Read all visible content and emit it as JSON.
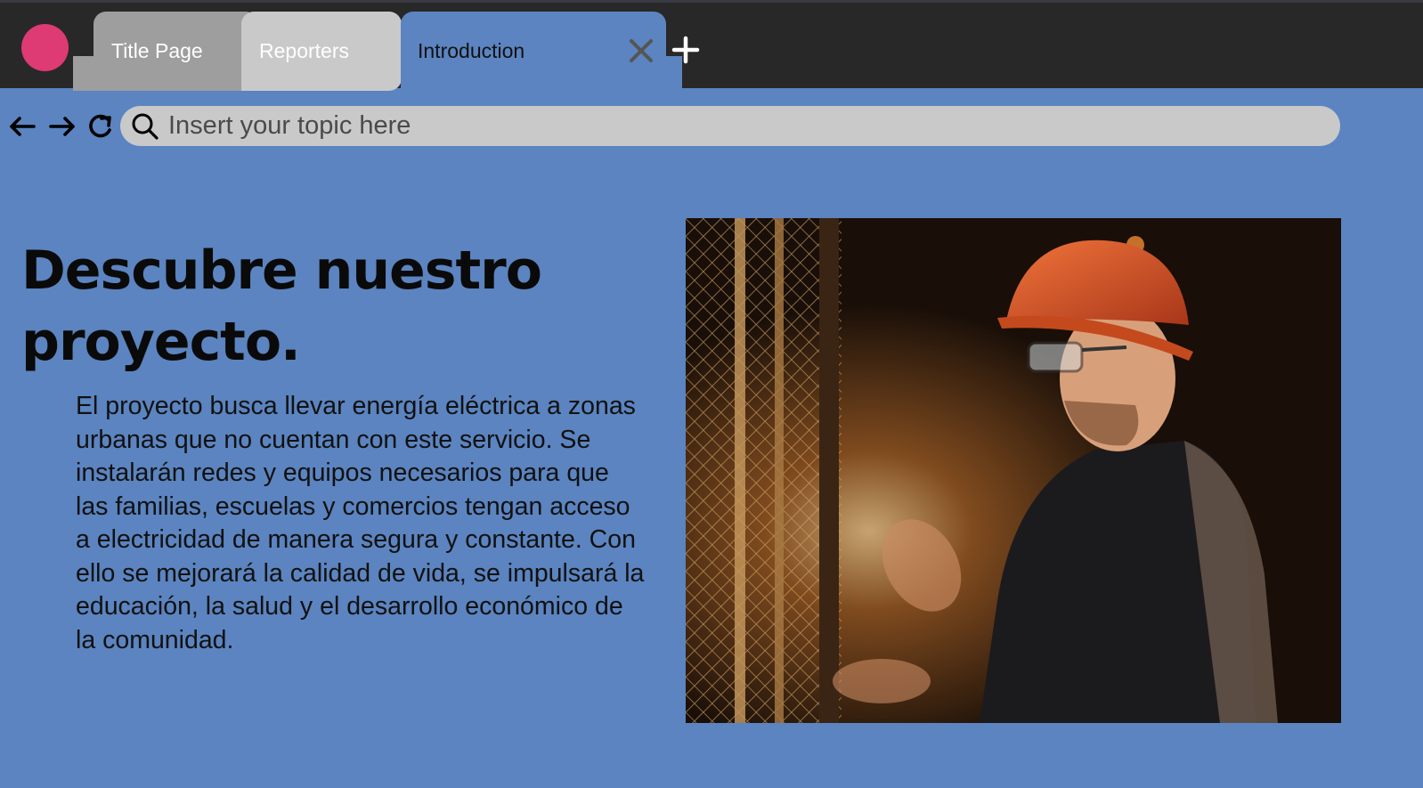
{
  "window": {
    "dot_color": "#de3a73",
    "tabs": [
      {
        "label": "Title Page",
        "state": "inactive"
      },
      {
        "label": "Reporters",
        "state": "inactive"
      },
      {
        "label": "Introduction",
        "state": "active"
      }
    ]
  },
  "nav": {
    "back_icon": "arrow-left-icon",
    "forward_icon": "arrow-right-icon",
    "reload_icon": "reload-icon"
  },
  "search": {
    "placeholder": "Insert your topic here",
    "value": ""
  },
  "content": {
    "headline": "Descubre nuestro proyecto.",
    "body": "El proyecto busca llevar energía eléctrica a zonas urbanas que no cuentan con este servicio. Se instalarán redes y equipos necesarios para que las familias, escuelas y comercios tengan acceso a electricidad de manera segura y constante. Con ello se mejorará la calidad de vida, se impulsará la educación, la salud y el desarrollo económico de la comunidad."
  },
  "colors": {
    "background": "#5b84c0",
    "titlebar": "#282828",
    "tab_inactive": "#9e9e9e",
    "tab_light": "#c9c9c9",
    "search_bg": "#c9c9c9"
  }
}
